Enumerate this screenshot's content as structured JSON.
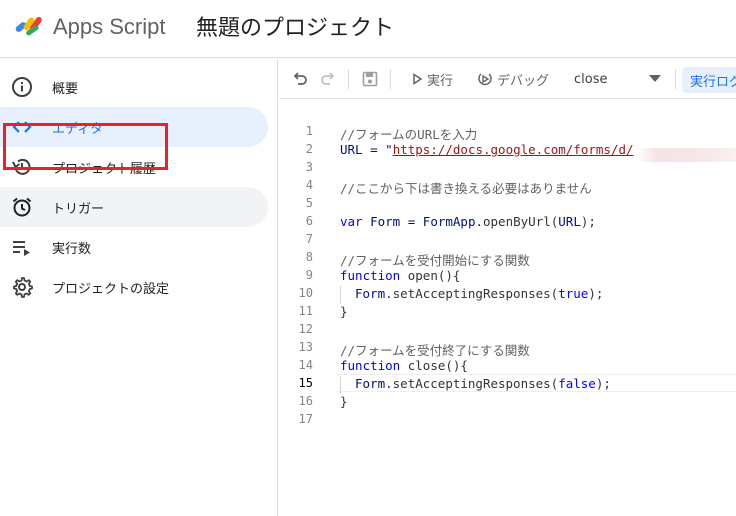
{
  "header": {
    "app_name": "Apps Script",
    "project_title": "無題のプロジェクト"
  },
  "sidebar": {
    "items": [
      {
        "label": "概要",
        "icon": "info-icon"
      },
      {
        "label": "エディタ",
        "icon": "code-icon"
      },
      {
        "label": "プロジェクト履歴",
        "icon": "history-icon"
      },
      {
        "label": "トリガー",
        "icon": "alarm-clock-icon"
      },
      {
        "label": "実行数",
        "icon": "executions-icon"
      },
      {
        "label": "プロジェクトの設定",
        "icon": "gear-icon"
      }
    ]
  },
  "toolbar": {
    "run_label": "実行",
    "debug_label": "デバッグ",
    "function_select": "close",
    "exec_log_label": "実行ログ"
  },
  "editor": {
    "line_numbers": [
      "1",
      "2",
      "3",
      "4",
      "5",
      "6",
      "7",
      "8",
      "9",
      "10",
      "11",
      "12",
      "13",
      "14",
      "15",
      "16",
      "17"
    ],
    "current_line": "15",
    "code": {
      "l1": "//フォームのURLを入力",
      "l2_pre": "URL = \"",
      "l2_url": "https://docs.google.com/forms/d/",
      "l4": "//ここから下は書き換える必要はありません",
      "l6_var": "var",
      "l6_rest_a": " Form = ",
      "l6_fn": "FormApp",
      "l6_rest_b": ".openByUrl(",
      "l6_arg": "URL",
      "l6_end": ");",
      "l8": "//フォームを受付開始にする関数",
      "l9_kw": "function",
      "l9_rest": " open(){",
      "l10_obj": "Form",
      "l10_call": ".setAcceptingResponses(",
      "l10_arg": "true",
      "l10_end": ");",
      "l11": "}",
      "l13": "//フォームを受付終了にする関数",
      "l14_kw": "function",
      "l14_rest": " close(){",
      "l15_obj": "Form",
      "l15_call": ".setAcceptingResponses(",
      "l15_arg": "false",
      "l15_end": ");",
      "l16": "}"
    }
  },
  "colors": {
    "accent": "#1a73e8",
    "active_bg": "#e8f0fe",
    "highlight_border": "#e5232b"
  }
}
